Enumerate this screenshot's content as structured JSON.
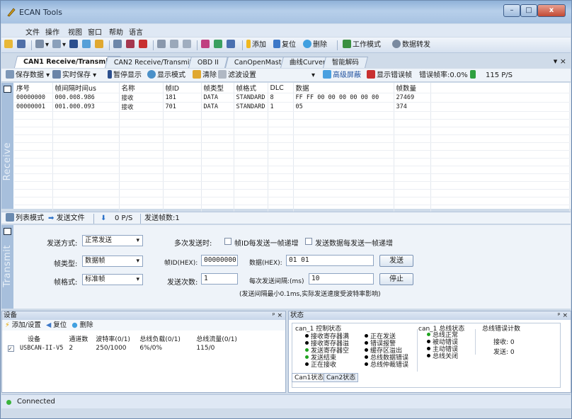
{
  "window": {
    "title": "ECAN Tools",
    "min": "–",
    "max": "□",
    "close": "x"
  },
  "menu": [
    "文件",
    "操作",
    "视图",
    "窗口",
    "帮助",
    "语言"
  ],
  "toolbar": {
    "add": "添加",
    "reset": "复位",
    "delete": "删除",
    "work_mode": "工作模式",
    "data_forward": "数据转发"
  },
  "tabs": [
    "CAN1 Receive/Transmit",
    "CAN2 Receive/Transmit",
    "OBD II",
    "CanOpenMaster",
    "曲线Curver",
    "智能解码"
  ],
  "tabs_pin": "▾ ×",
  "subtool": {
    "save_data": "保存数据",
    "realtime_save": "实时保存",
    "pause": "暂停显示",
    "display_mode": "显示模式",
    "clear": "清除",
    "filter": "滤波设置",
    "advanced_mask": "高级屏蔽",
    "show_error_frame": "显示错误帧",
    "error_rate": "错误帧率:0.0%",
    "pps": "115 P/S"
  },
  "receive": {
    "side_label": "Receive",
    "columns": [
      "序号",
      "帧间隔时间us",
      "名称",
      "帧ID",
      "帧类型",
      "帧格式",
      "DLC",
      "数据",
      "帧数量"
    ],
    "rows": [
      [
        "00000000",
        "000.008.986",
        "接收",
        "181",
        "DATA",
        "STANDARD",
        "8",
        "FF FF 00 00 00 00 00 00",
        "27469"
      ],
      [
        "00000001",
        "001.000.093",
        "接收",
        "701",
        "DATA",
        "STANDARD",
        "1",
        "05",
        "374"
      ]
    ]
  },
  "sendbar": {
    "list_mode": "列表模式",
    "send_file": "发送文件",
    "pps": "0 P/S",
    "sent_count": "发送帧数:1"
  },
  "transmit": {
    "side_label": "Transmit",
    "send_mode_label": "发送方式:",
    "send_mode_value": "正常发送",
    "multi_send_label": "多次发送时:",
    "chk_id_inc": "帧ID每发送一帧递增",
    "chk_data_inc": "发送数据每发送一帧递增",
    "frame_type_label": "帧类型:",
    "frame_type_value": "数据帧",
    "frame_id_label": "帧ID(HEX):",
    "frame_id_value": "00000000",
    "data_label": "数据(HEX):",
    "data_value": "01 01",
    "send_button": "发送",
    "frame_format_label": "帧格式:",
    "frame_format_value": "标准帧",
    "send_count_label": "发送次数:",
    "send_count_value": "1",
    "interval_label": "每次发送间隔:(ms)",
    "interval_value": "10",
    "stop_button": "停止",
    "note": "(发送间隔最小0.1ms,实际发送速度受波特率影响)"
  },
  "device_panel": {
    "title": "设备",
    "pin": "ᵖ ×",
    "add": "添加/设置",
    "reset": "复位",
    "delete": "删除",
    "columns": [
      "设备",
      "通道数",
      "波特率(0/1)",
      "总线负载(0/1)",
      "总线流量(0/1)"
    ],
    "rows": [
      [
        "USBCAN-II-V5",
        "2",
        "250/1000",
        "6%/0%",
        "115/0"
      ]
    ]
  },
  "status_panel": {
    "title": "状态",
    "pin": "ᵖ ×",
    "ctrl_title": "can_1 控制状态",
    "ctrl_col1": [
      "接收寄存器满",
      "接收寄存器溢",
      "发送寄存器空",
      "发送结束",
      "正在接收"
    ],
    "ctrl_col2": [
      "正在发送",
      "错误报警",
      "缓存区溢出",
      "总线数据错误",
      "总线仲裁错误"
    ],
    "bus_title": "can_1 总线状态",
    "bus_items": [
      "总线正常",
      "被动错误",
      "主动错误",
      "总线关闭"
    ],
    "err_title": "总线错误计数",
    "err_recv": "接收:  0",
    "err_send": "发送:  0",
    "tabs": [
      "Can1状态",
      "Can2状态"
    ]
  },
  "status_bar": {
    "text": "Connected"
  }
}
